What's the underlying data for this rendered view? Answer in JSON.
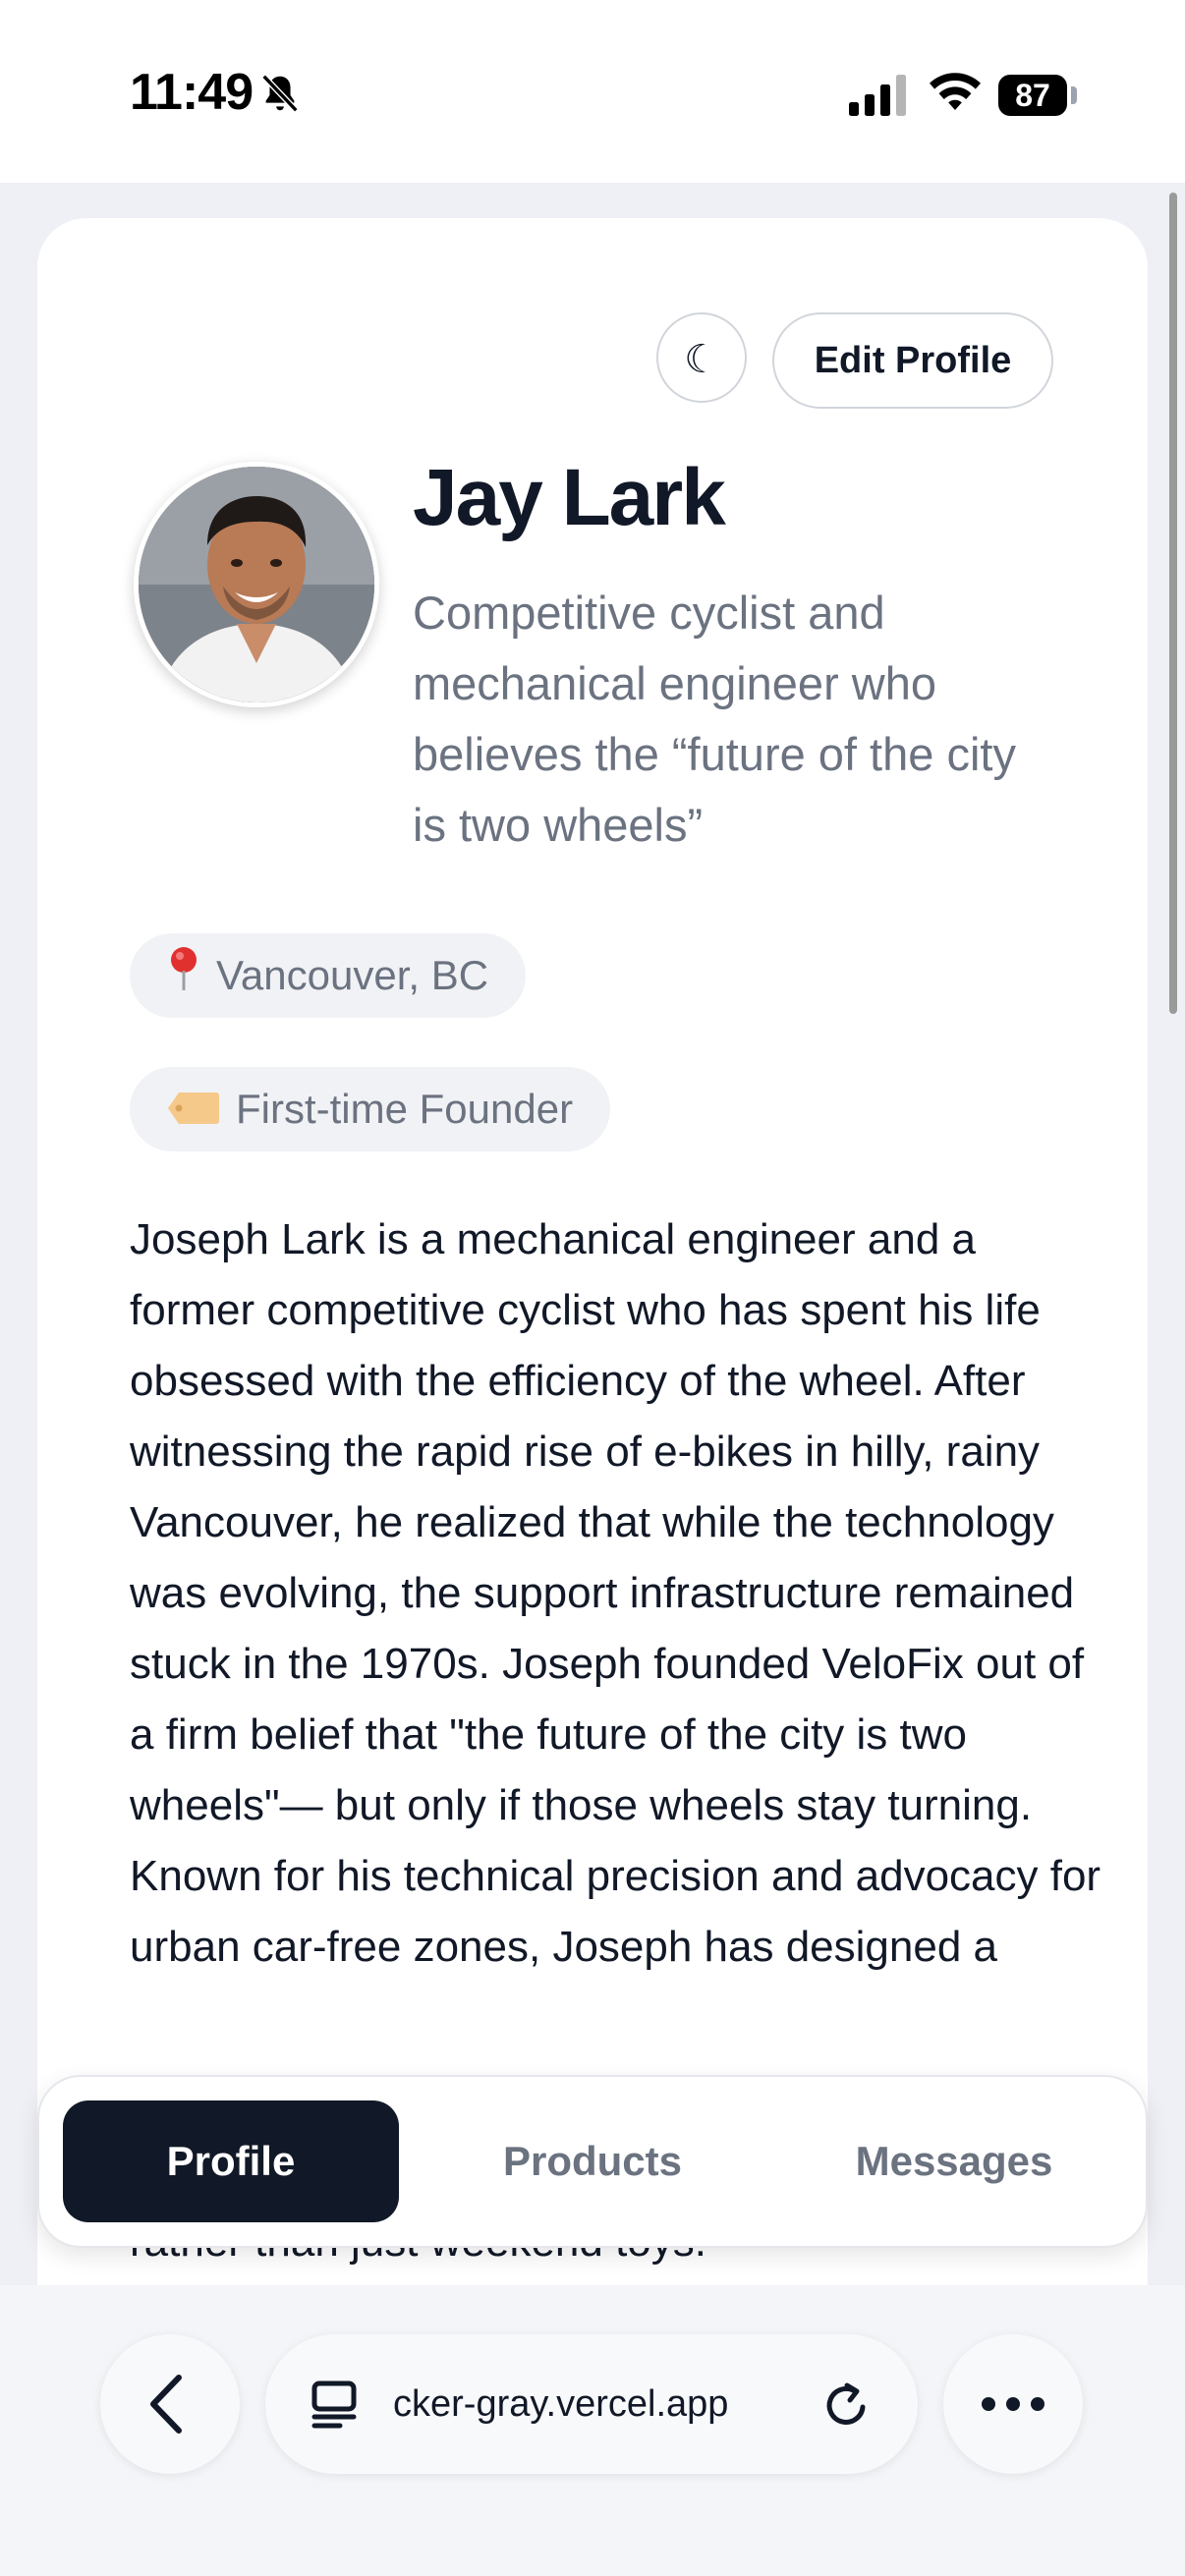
{
  "status_bar": {
    "time": "11:49",
    "battery": "87"
  },
  "header": {
    "theme_toggle_glyph": "☾",
    "edit_profile_label": "Edit Profile"
  },
  "profile": {
    "name": "Jay Lark",
    "tagline": "Competitive cyclist and mechanical engineer who believes the “future of the city is two wheels”",
    "location": "Vancouver, BC",
    "location_icon": "pin-icon",
    "badge": "First-time Founder",
    "badge_icon": "tag-icon",
    "bio": "Joseph Lark is a mechanical engineer and a former competitive cyclist who has spent his life obsessed with the efficiency of the wheel. After witnessing the rapid rise of e-bikes in hilly, rainy Vancouver, he realized that while the technology was evolving, the support infrastructure remained stuck in the 1970s. Joseph founded VeloFix out of a firm belief that \"the future of the city is two wheels\"— but only if those wheels stay turning. Known for his technical precision and advocacy for urban car-free zones, Joseph has designed a",
    "bio_tail": "rather than just weekend toys."
  },
  "tabs": [
    {
      "label": "Profile",
      "active": true
    },
    {
      "label": "Products",
      "active": false
    },
    {
      "label": "Messages",
      "active": false
    }
  ],
  "browser": {
    "url": "cker-gray.vercel.app"
  },
  "colors": {
    "accent_dark": "#111827",
    "muted_text": "#6b7280",
    "chip_bg": "#f1f2f5"
  }
}
